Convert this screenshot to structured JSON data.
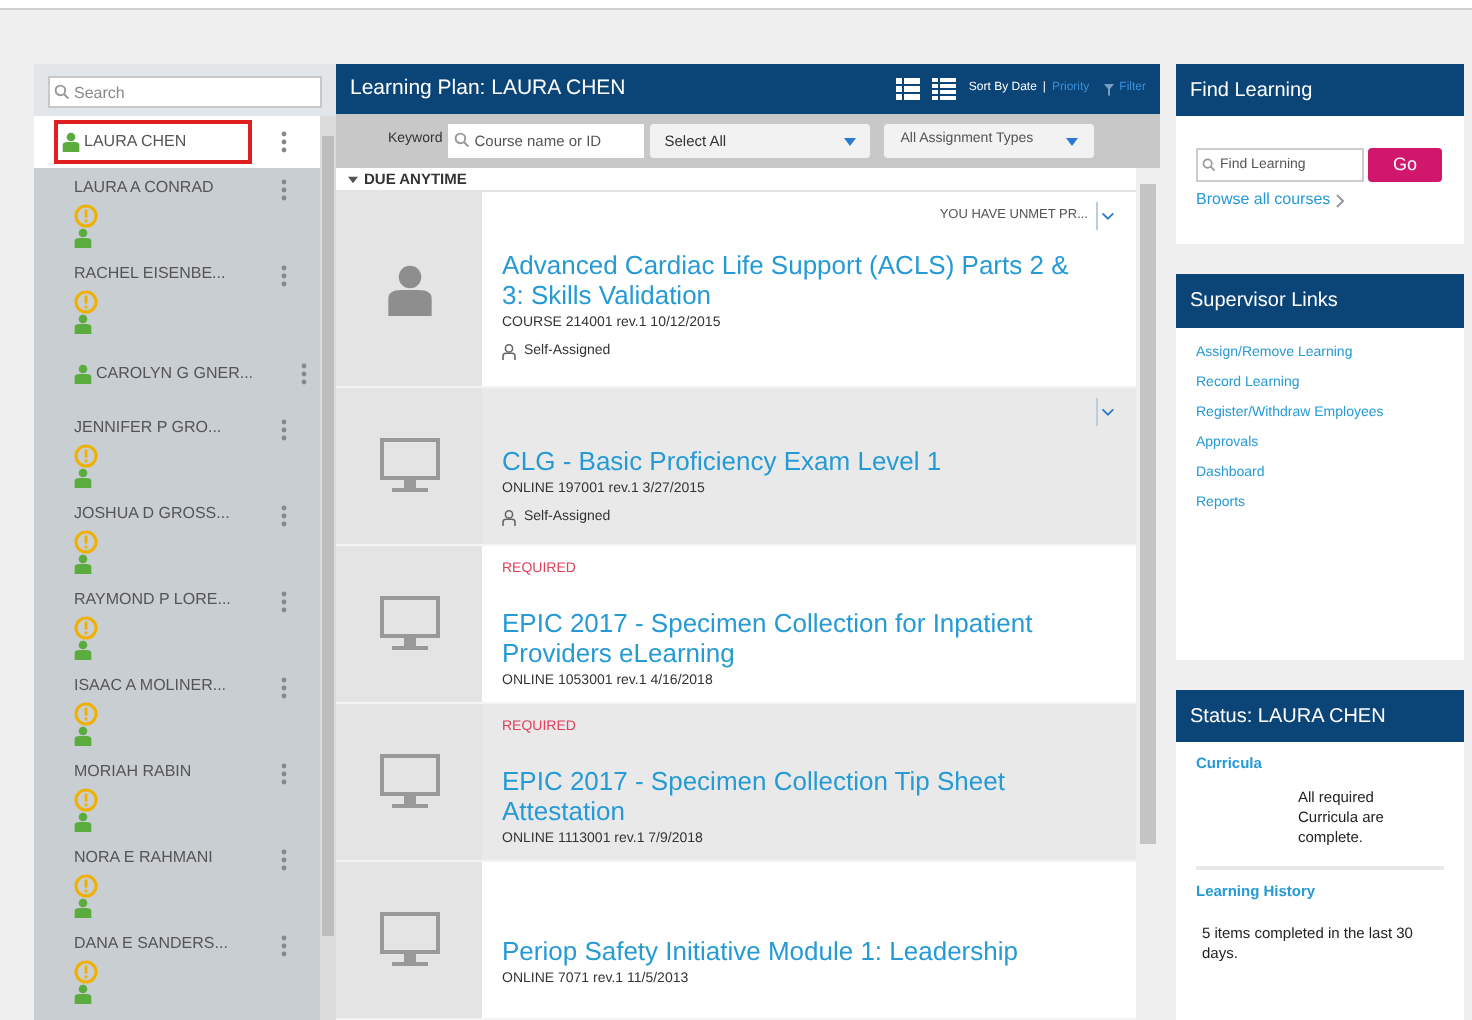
{
  "employees": {
    "search_placeholder": "Search",
    "items": [
      {
        "name": "LAURA CHEN",
        "selected": true,
        "warning": false
      },
      {
        "name": "LAURA A CONRAD",
        "selected": false,
        "warning": true
      },
      {
        "name": "RACHEL EISENBE...",
        "selected": false,
        "warning": true
      },
      {
        "name": "CAROLYN G GNER...",
        "selected": false,
        "warning": false
      },
      {
        "name": "JENNIFER P GRO...",
        "selected": false,
        "warning": true
      },
      {
        "name": "JOSHUA D GROSS...",
        "selected": false,
        "warning": true
      },
      {
        "name": "RAYMOND P LORE...",
        "selected": false,
        "warning": true
      },
      {
        "name": "ISAAC A MOLINER...",
        "selected": false,
        "warning": true
      },
      {
        "name": "MORIAH RABIN",
        "selected": false,
        "warning": true
      },
      {
        "name": "NORA E RAHMANI",
        "selected": false,
        "warning": true
      },
      {
        "name": "DANA E SANDERS...",
        "selected": false,
        "warning": true
      }
    ]
  },
  "plan": {
    "title": "Learning Plan: LAURA CHEN",
    "sort_label": "Sort By Date",
    "sort_separator": "|",
    "sort_options": [
      {
        "label": "Priority",
        "selected": false
      }
    ],
    "filter": "Filter",
    "keyword_label": "Keyword",
    "keyword_placeholder": "Course name or ID",
    "select_all": "Select All",
    "assignment_types": "All Assignment Types",
    "group": "DUE ANYTIME",
    "courses": [
      {
        "kind": "person",
        "shaded": false,
        "notice": "YOU HAVE UNMET PR...",
        "expandable": true,
        "title": "Advanced Cardiac Life Support (ACLS) Parts 2 & 3: Skills Validation",
        "meta": "COURSE 214001 rev.1 10/12/2015",
        "assigned": "Self-Assigned"
      },
      {
        "kind": "monitor",
        "shaded": true,
        "expandable": true,
        "title": "CLG - Basic Proficiency Exam Level 1",
        "meta": "ONLINE 197001 rev.1 3/27/2015",
        "assigned": "Self-Assigned"
      },
      {
        "kind": "monitor",
        "shaded": false,
        "expandable": false,
        "required": "REQUIRED",
        "title": "EPIC 2017 - Specimen Collection for Inpatient Providers eLearning",
        "meta": "ONLINE 1053001 rev.1 4/16/2018"
      },
      {
        "kind": "monitor",
        "shaded": true,
        "expandable": false,
        "required": "REQUIRED",
        "title": "EPIC 2017 - Specimen Collection Tip Sheet Attestation",
        "meta": "ONLINE 1113001 rev.1 7/9/2018"
      },
      {
        "kind": "monitor",
        "shaded": false,
        "expandable": false,
        "title": "Periop Safety Initiative Module 1: Leadership",
        "meta": "ONLINE 7071 rev.1 11/5/2013"
      }
    ]
  },
  "find_learning": {
    "title": "Find Learning",
    "placeholder": "Find Learning",
    "button": "Go",
    "browse": "Browse all courses"
  },
  "supervisor_links": {
    "title": "Supervisor Links",
    "links": [
      "Assign/Remove Learning",
      "Record Learning",
      "Register/Withdraw Employees",
      "Approvals",
      "Dashboard",
      "Reports"
    ]
  },
  "status": {
    "title": "Status: LAURA CHEN",
    "curricula_heading": "Curricula",
    "curricula_text": "All required Curricula are complete.",
    "history_heading": "Learning History",
    "history_text": "5 items completed in the last 30 days."
  }
}
